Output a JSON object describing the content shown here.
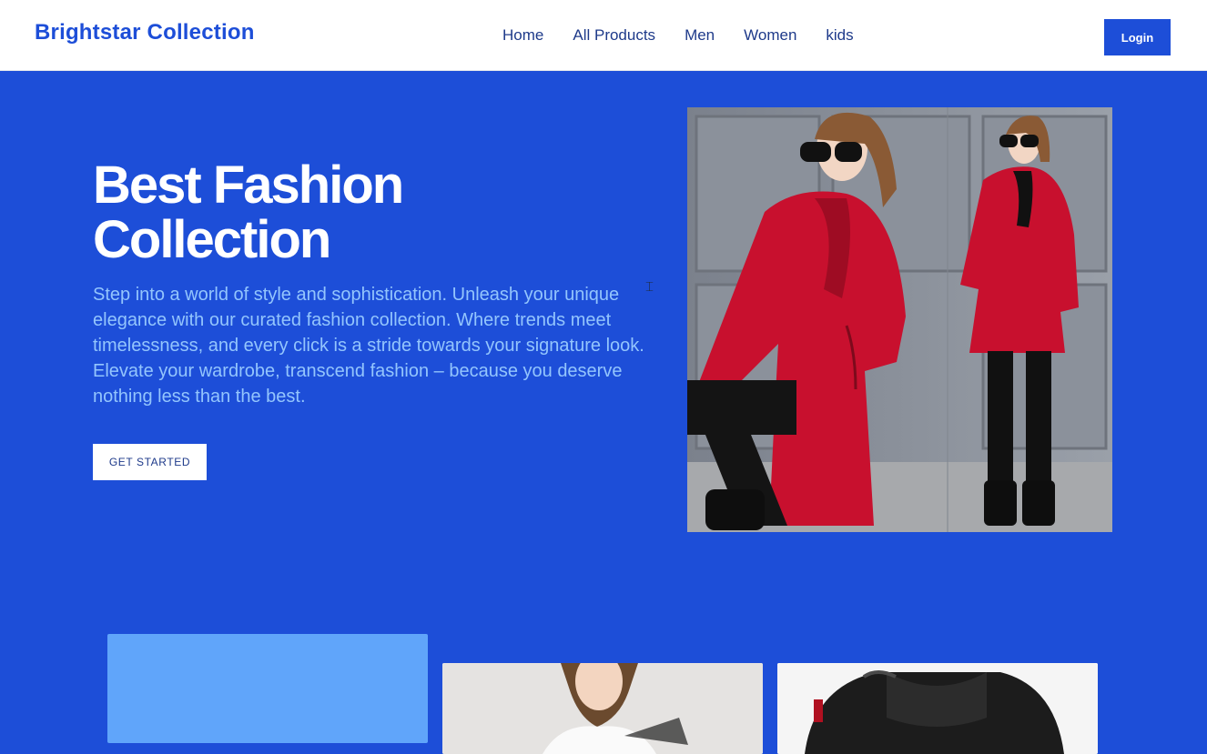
{
  "navbar": {
    "brand": "Brightstar Collection",
    "links": [
      "Home",
      "All Products",
      "Men",
      "Women",
      "kids"
    ],
    "login_label": "Login"
  },
  "hero": {
    "title": "Best Fashion Collection",
    "description": "Step into a world of style and sophistication. Unleash your unique elegance with our curated fashion collection. Where trends meet timelessness, and every click is a stride towards your signature look. Elevate your wardrobe, transcend fashion – because you deserve nothing less than the best.",
    "cta_label": "GET STARTED",
    "image_icon": "photo-woman-red-coat"
  },
  "cards": [
    {
      "icon": "category-card"
    },
    {
      "icon": "photo-woman-smiling"
    },
    {
      "icon": "photo-black-puffer-jacket"
    }
  ],
  "colors": {
    "primary": "#1d4ed8",
    "text_light": "#93c5fd",
    "card_highlight": "#60a5fa",
    "coat_red": "#c8102e"
  }
}
